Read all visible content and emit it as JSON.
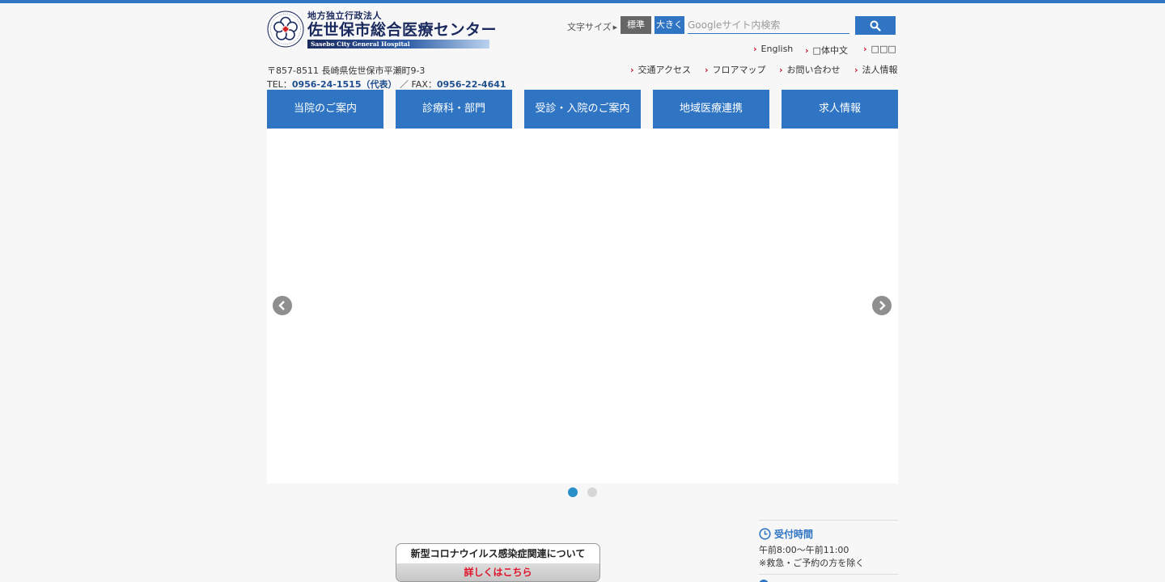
{
  "header": {
    "logo_subtitle": "地方独立行政法人",
    "logo_title": "佐世保市総合医療センター",
    "logo_english": "Sasebo City General Hospital",
    "font_size_label": "文字サイズ",
    "font_size_standard": "標準",
    "font_size_large": "大きく",
    "search_placeholder": "Googleサイト内検索",
    "search_icon": "search-icon"
  },
  "languages": {
    "english": "English",
    "chinese": "□体中文",
    "korean": "□□□"
  },
  "utility_links": {
    "access": "交通アクセス",
    "floor_map": "フロアマップ",
    "contact": "お問い合わせ",
    "corporate": "法人情報"
  },
  "address": {
    "postal": "〒857-8511 長崎県佐世保市平瀬町9-3",
    "tel_label": "TEL：",
    "tel_number": "0956-24-1515（代表）",
    "separator": "／",
    "fax_label": "FAX：",
    "fax_number": "0956-22-4641"
  },
  "nav": {
    "items": [
      {
        "label": "当院のご案内"
      },
      {
        "label": "診療科・部門"
      },
      {
        "label": "受診・入院のご案内"
      },
      {
        "label": "地域医療連携"
      },
      {
        "label": "求人情報"
      }
    ]
  },
  "slider": {
    "active_slide": 1,
    "slide_count": 2
  },
  "covid_banner": {
    "title": "新型コロナウイルス感染症関連について",
    "link": "詳しくはこちら"
  },
  "reception": {
    "title": "受付時間",
    "hours": "午前8:00〜午前11:00",
    "note": "※救急・ご予約の方を除く"
  },
  "colors": {
    "primary": "#2f75c4",
    "accent_red": "#c8102e",
    "dot_active": "#2a8ec9"
  }
}
